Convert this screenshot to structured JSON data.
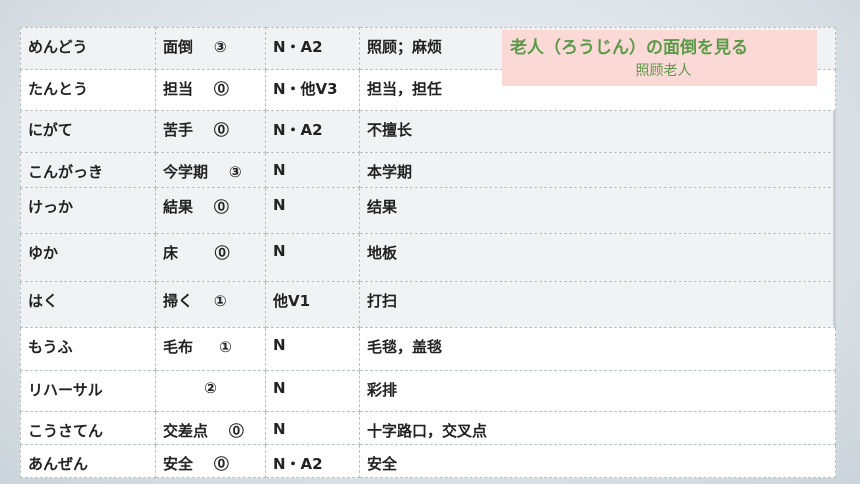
{
  "rows": [
    {
      "kana": "めんどう",
      "kanji": "面倒",
      "accent": "③",
      "type": "N・A2",
      "meaning": "照顾；麻烦"
    },
    {
      "kana": "たんとう",
      "kanji": "担当",
      "accent": "⓪",
      "type": "N・他V3",
      "meaning": "担当，担任"
    },
    {
      "kana": "にがて",
      "kanji": "苦手",
      "accent": "⓪",
      "type": "N・A2",
      "meaning": "不擅长"
    },
    {
      "kana": "こんがっき",
      "kanji": "今学期",
      "accent": "③",
      "type": "N",
      "meaning": "本学期"
    },
    {
      "kana": "けっか",
      "kanji": "結果",
      "accent": "⓪",
      "type": "N",
      "meaning": "结果"
    },
    {
      "kana": "ゆか",
      "kanji": "床",
      "accent": "⓪",
      "type": "N",
      "meaning": "地板"
    },
    {
      "kana": "はく",
      "kanji": "掃く",
      "accent": "①",
      "type": "他V1",
      "meaning": "打扫"
    },
    {
      "kana": "もうふ",
      "kanji": "毛布",
      "accent": "①",
      "type": "N",
      "meaning": "毛毯，盖毯"
    },
    {
      "kana": "リハーサル",
      "kanji": "",
      "accent": "②",
      "type": "N",
      "meaning": "彩排"
    },
    {
      "kana": "こうさてん",
      "kanji": "交差点",
      "accent": "⓪",
      "type": "N",
      "meaning": "十字路口，交叉点"
    },
    {
      "kana": "あんぜん",
      "kanji": "安全",
      "accent": "⓪",
      "type": "N・A2",
      "meaning": "安全"
    }
  ],
  "note": {
    "title": "老人（ろうじん）の面倒を見る",
    "subtitle": "照顾老人"
  }
}
